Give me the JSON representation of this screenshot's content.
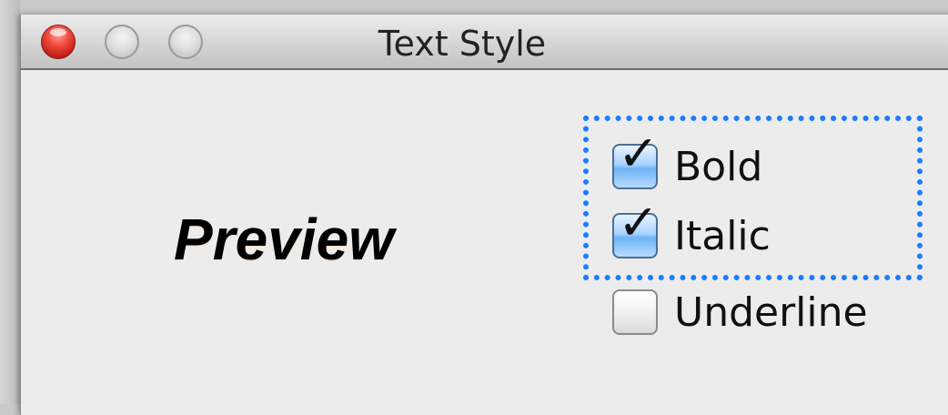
{
  "window": {
    "title": "Text Style"
  },
  "preview": {
    "text": "Preview"
  },
  "checkboxes": [
    {
      "label": "Bold",
      "checked": true
    },
    {
      "label": "Italic",
      "checked": true
    },
    {
      "label": "Underline",
      "checked": false
    }
  ],
  "colors": {
    "focus_ring": "#1a7cff",
    "window_bg": "#ececec",
    "close_button": "#f0463b",
    "checkbox_checked": "#6fb3f7"
  },
  "icons": {
    "close": "close-icon",
    "minimize": "minimize-icon",
    "zoom": "zoom-icon",
    "checkmark": "checkmark-icon",
    "resize": "resize-grip-icon"
  }
}
